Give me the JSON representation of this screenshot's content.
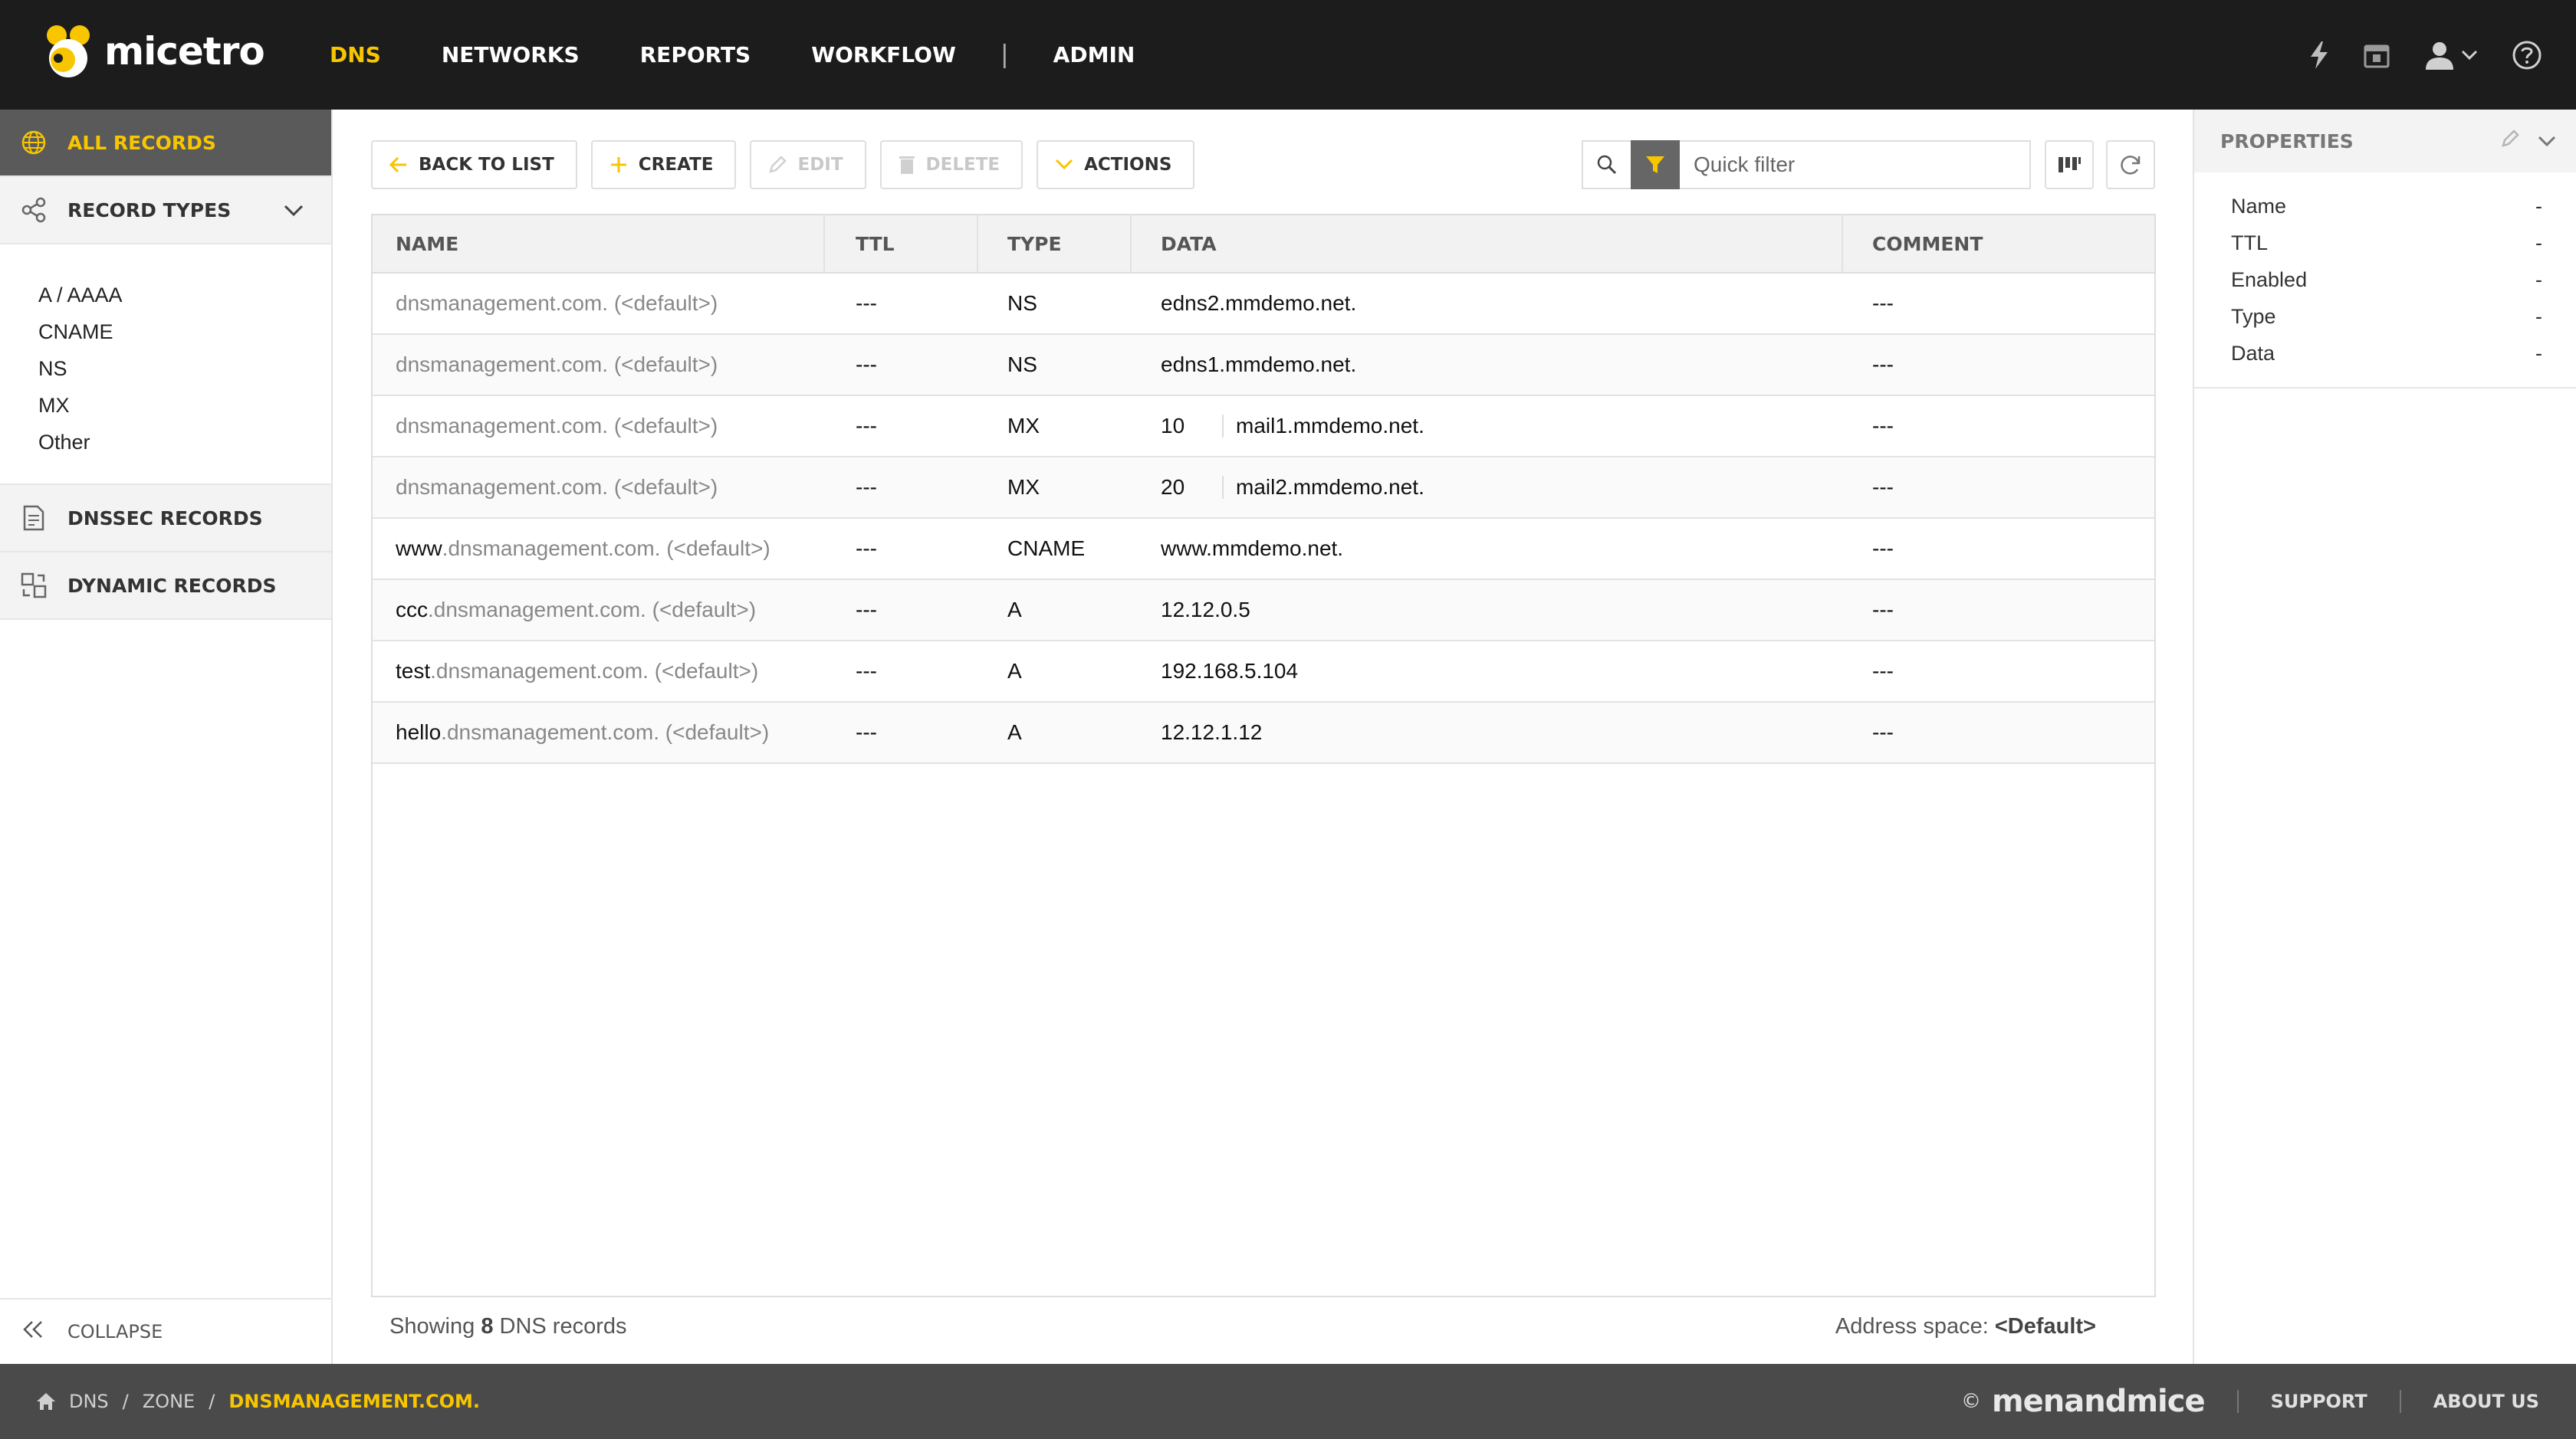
{
  "app": {
    "name": "micetro"
  },
  "topnav": {
    "items": [
      {
        "label": "DNS",
        "active": true
      },
      {
        "label": "NETWORKS",
        "active": false
      },
      {
        "label": "REPORTS",
        "active": false
      },
      {
        "label": "WORKFLOW",
        "active": false
      }
    ],
    "separator": "|",
    "admin_label": "ADMIN",
    "icons": [
      "lightning-icon",
      "calendar-icon",
      "user-icon",
      "help-icon"
    ]
  },
  "sidebar": {
    "all_records": "ALL RECORDS",
    "record_types": "RECORD TYPES",
    "record_type_items": [
      "A / AAAA",
      "CNAME",
      "NS",
      "MX",
      "Other"
    ],
    "dnssec_records": "DNSSEC RECORDS",
    "dynamic_records": "DYNAMIC RECORDS",
    "collapse": "COLLAPSE"
  },
  "toolbar": {
    "back": "BACK TO LIST",
    "create": "CREATE",
    "edit": "EDIT",
    "delete": "DELETE",
    "actions": "ACTIONS",
    "quick_filter_placeholder": "Quick filter"
  },
  "table": {
    "columns": [
      "NAME",
      "TTL",
      "TYPE",
      "DATA",
      "COMMENT"
    ],
    "rows": [
      {
        "host": "",
        "name": "dnsmanagement.com. (<default>)",
        "ttl": "---",
        "type": "NS",
        "data_pri": "",
        "data": "edns2.mmdemo.net.",
        "comment": "---"
      },
      {
        "host": "",
        "name": "dnsmanagement.com. (<default>)",
        "ttl": "---",
        "type": "NS",
        "data_pri": "",
        "data": "edns1.mmdemo.net.",
        "comment": "---"
      },
      {
        "host": "",
        "name": "dnsmanagement.com. (<default>)",
        "ttl": "---",
        "type": "MX",
        "data_pri": "10",
        "data": "mail1.mmdemo.net.",
        "comment": "---"
      },
      {
        "host": "",
        "name": "dnsmanagement.com. (<default>)",
        "ttl": "---",
        "type": "MX",
        "data_pri": "20",
        "data": "mail2.mmdemo.net.",
        "comment": "---"
      },
      {
        "host": "www",
        "name": ".dnsmanagement.com. (<default>)",
        "ttl": "---",
        "type": "CNAME",
        "data_pri": "",
        "data": "www.mmdemo.net.",
        "comment": "---"
      },
      {
        "host": "ccc",
        "name": ".dnsmanagement.com. (<default>)",
        "ttl": "---",
        "type": "A",
        "data_pri": "",
        "data": "12.12.0.5",
        "comment": "---"
      },
      {
        "host": "test",
        "name": ".dnsmanagement.com. (<default>)",
        "ttl": "---",
        "type": "A",
        "data_pri": "",
        "data": "192.168.5.104",
        "comment": "---"
      },
      {
        "host": "hello",
        "name": ".dnsmanagement.com. (<default>)",
        "ttl": "---",
        "type": "A",
        "data_pri": "",
        "data": "12.12.1.12",
        "comment": "---"
      }
    ]
  },
  "status": {
    "showing_prefix": "Showing",
    "count": "8",
    "showing_suffix": "DNS records",
    "address_space_label": "Address space:",
    "address_space_value": "<Default>"
  },
  "properties": {
    "title": "PROPERTIES",
    "fields": [
      {
        "label": "Name",
        "value": "-"
      },
      {
        "label": "TTL",
        "value": "-"
      },
      {
        "label": "Enabled",
        "value": "-"
      },
      {
        "label": "Type",
        "value": "-"
      },
      {
        "label": "Data",
        "value": "-"
      }
    ]
  },
  "breadcrumb": [
    "DNS",
    "ZONE",
    "DNSMANAGEMENT.COM."
  ],
  "footer": {
    "copyright": "©",
    "brand": "menandmice",
    "support": "SUPPORT",
    "about": "ABOUT US"
  },
  "colors": {
    "accent": "#f7c600",
    "topbar": "#1c1c1c",
    "bottombar": "#4a4a4a"
  }
}
